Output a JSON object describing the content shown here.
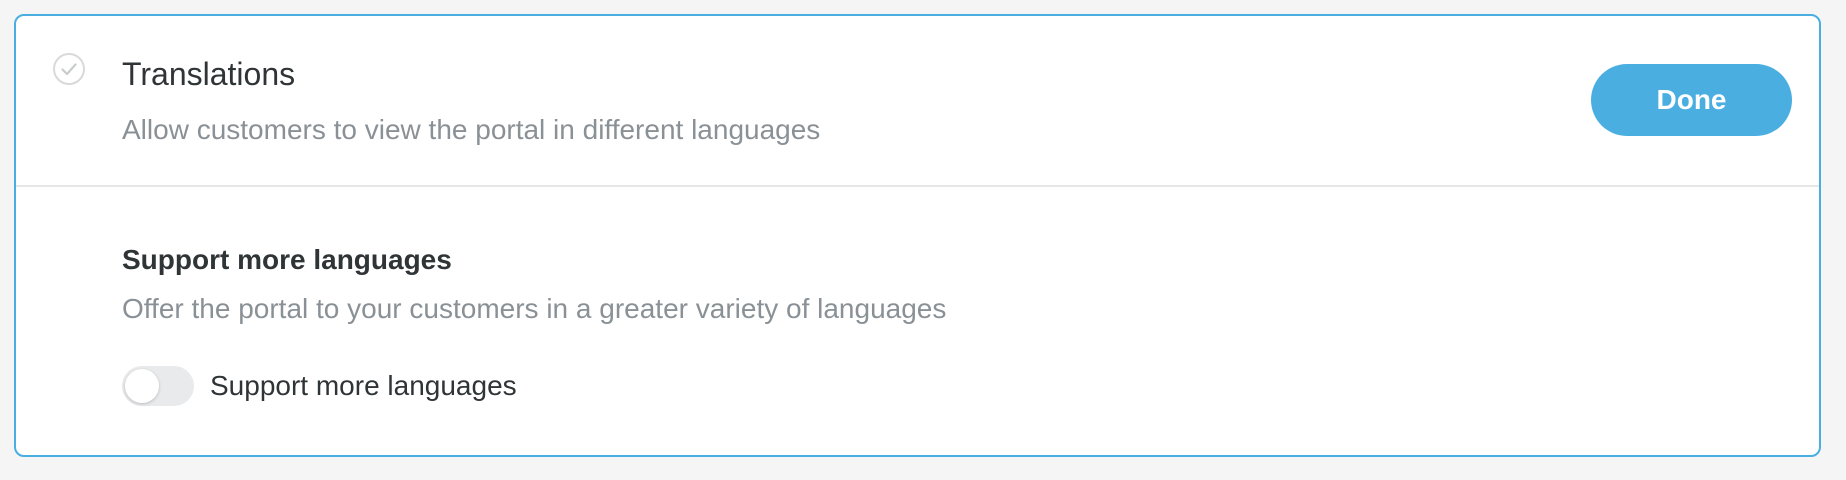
{
  "card": {
    "title": "Translations",
    "subtitle": "Allow customers to view the portal in different languages",
    "done_label": "Done",
    "status_icon": "check-circle-icon"
  },
  "section": {
    "title": "Support more languages",
    "description": "Offer the portal to your customers in a greater variety of languages",
    "toggle_label": "Support more languages",
    "toggle_on": false
  },
  "colors": {
    "accent": "#4aaee0",
    "text_primary": "#2f3437",
    "text_secondary": "#8a9196",
    "divider": "#e6e6e6",
    "toggle_off": "#e9eaec"
  }
}
